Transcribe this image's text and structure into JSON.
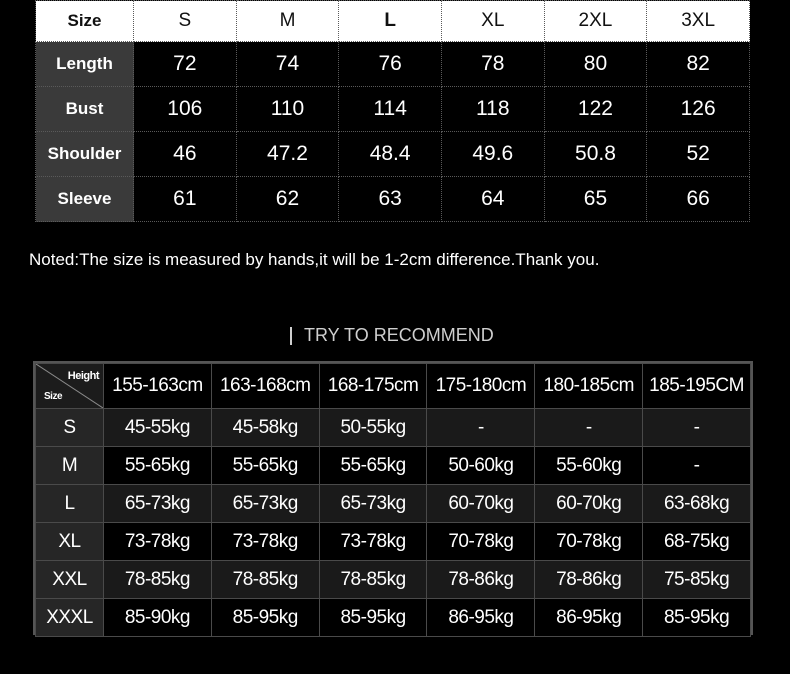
{
  "size_chart": {
    "header_label": "Size",
    "sizes": [
      "S",
      "M",
      "L",
      "XL",
      "2XL",
      "3XL"
    ],
    "rows": [
      {
        "label": "Length",
        "values": [
          "72",
          "74",
          "76",
          "78",
          "80",
          "82"
        ]
      },
      {
        "label": "Bust",
        "values": [
          "106",
          "110",
          "114",
          "118",
          "122",
          "126"
        ]
      },
      {
        "label": "Shoulder",
        "values": [
          "46",
          "47.2",
          "48.4",
          "49.6",
          "50.8",
          "52"
        ]
      },
      {
        "label": "Sleeve",
        "values": [
          "61",
          "62",
          "63",
          "64",
          "65",
          "66"
        ]
      }
    ]
  },
  "note": "Noted:The size is measured by hands,it will be 1-2cm difference.Thank you.",
  "recommend_title": "TRY TO RECOMMEND",
  "recommend_chart": {
    "corner_height_label": "Height",
    "corner_size_label": "Size",
    "heights": [
      "155-163cm",
      "163-168cm",
      "168-175cm",
      "175-180cm",
      "180-185cm",
      "185-195CM"
    ],
    "rows": [
      {
        "size": "S",
        "values": [
          "45-55kg",
          "45-58kg",
          "50-55kg",
          "-",
          "-",
          "-"
        ]
      },
      {
        "size": "M",
        "values": [
          "55-65kg",
          "55-65kg",
          "55-65kg",
          "50-60kg",
          "55-60kg",
          "-"
        ]
      },
      {
        "size": "L",
        "values": [
          "65-73kg",
          "65-73kg",
          "65-73kg",
          "60-70kg",
          "60-70kg",
          "63-68kg"
        ]
      },
      {
        "size": "XL",
        "values": [
          "73-78kg",
          "73-78kg",
          "73-78kg",
          "70-78kg",
          "70-78kg",
          "68-75kg"
        ]
      },
      {
        "size": "XXL",
        "values": [
          "78-85kg",
          "78-85kg",
          "78-85kg",
          "78-86kg",
          "78-86kg",
          "75-85kg"
        ]
      },
      {
        "size": "XXXL",
        "values": [
          "85-90kg",
          "85-95kg",
          "85-95kg",
          "86-95kg",
          "86-95kg",
          "85-95kg"
        ]
      }
    ]
  }
}
